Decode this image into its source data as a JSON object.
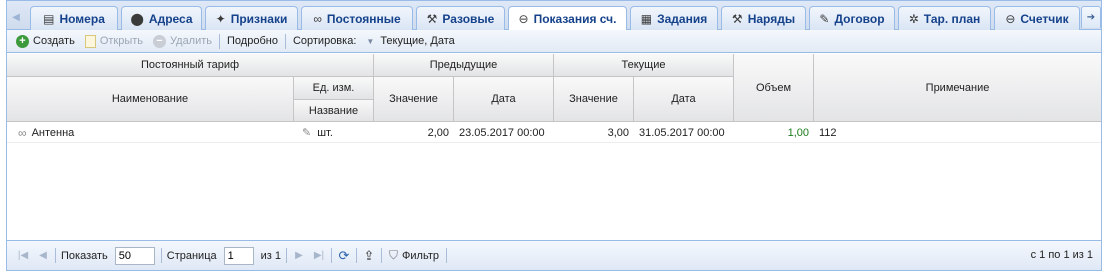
{
  "tabs": [
    {
      "label": "Номера",
      "icon": "document-icon",
      "glyph": "▤",
      "active": false
    },
    {
      "label": "Адреса",
      "icon": "map-pin-icon",
      "glyph": "📍",
      "active": false
    },
    {
      "label": "Признаки",
      "icon": "tags-icon",
      "glyph": "🏷",
      "active": false
    },
    {
      "label": "Постоянные",
      "icon": "link-icon",
      "glyph": "🔗",
      "active": false
    },
    {
      "label": "Разовые",
      "icon": "wrench-icon",
      "glyph": "🔧",
      "active": false
    },
    {
      "label": "Показания сч.",
      "icon": "minus-circle-icon",
      "glyph": "⊖",
      "active": true
    },
    {
      "label": "Задания",
      "icon": "clipboard-icon",
      "glyph": "📋",
      "active": false
    },
    {
      "label": "Наряды",
      "icon": "tools-icon",
      "glyph": "🔨",
      "active": false
    },
    {
      "label": "Договор",
      "icon": "edit-document-icon",
      "glyph": "📝",
      "active": false
    },
    {
      "label": "Тар. план",
      "icon": "network-icon",
      "glyph": "✲",
      "active": false
    },
    {
      "label": "Счетчик",
      "icon": "counter-icon",
      "glyph": "⊖",
      "active": false
    }
  ],
  "toolbar": {
    "create": "Создать",
    "open": "Открыть",
    "delete": "Удалить",
    "details": "Подробно",
    "sort_label": "Сортировка:",
    "sort_value": "Текущие, Дата"
  },
  "grid": {
    "headers": {
      "tariff": "Постоянный тариф",
      "name": "Наименование",
      "unit_group": "Ед. изм.",
      "unit_name": "Название",
      "previous": "Предыдущие",
      "current": "Текущие",
      "value": "Значение",
      "date": "Дата",
      "volume": "Объем",
      "note": "Примечание"
    },
    "rows": [
      {
        "name": "Антенна",
        "unit": "шт.",
        "prev_value": "2,00",
        "prev_date": "23.05.2017 00:00",
        "cur_value": "3,00",
        "cur_date": "31.05.2017 00:00",
        "volume": "1,00",
        "note": "112"
      }
    ]
  },
  "paging": {
    "show_label": "Показать",
    "page_size": "50",
    "page_label": "Страница",
    "page": "1",
    "of_label": "из 1",
    "filter_label": "Фильтр",
    "info": "с 1 по 1 из 1"
  }
}
